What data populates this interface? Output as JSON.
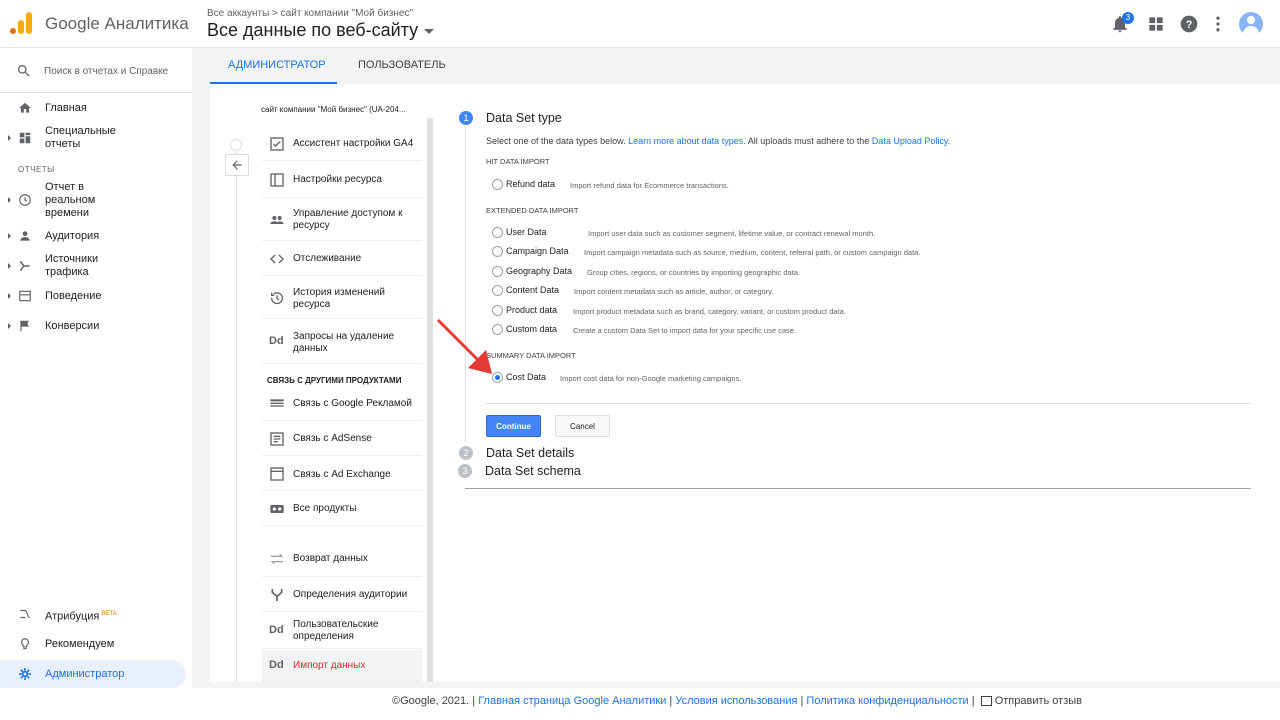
{
  "header": {
    "product": "Google Аналитика",
    "breadcrumb": "Все аккаунты > сайт компании \"Мой бизнес\"",
    "view": "Все данные по веб-сайту",
    "notifications_count": "3"
  },
  "leftnav": {
    "search_placeholder": "Поиск в отчетах и Справке",
    "items": [
      {
        "label": "Главная"
      },
      {
        "label": "Специальные отчеты"
      },
      {
        "label": "Отчет в реальном времени"
      },
      {
        "label": "Аудитория"
      },
      {
        "label": "Источники трафика"
      },
      {
        "label": "Поведение"
      },
      {
        "label": "Конверсии"
      },
      {
        "label": "Атрибуция"
      },
      {
        "label": "Рекомендуем"
      },
      {
        "label": "Администратор"
      }
    ],
    "section_reports": "ОТЧЕТЫ",
    "beta": "BETA"
  },
  "tabs": {
    "admin": "АДМИНИСТРАТОР",
    "user": "ПОЛЬЗОВАТЕЛЬ"
  },
  "property": {
    "title": "сайт компании \"Мой бизнес\" (UA-204...",
    "items": [
      {
        "label": "Ассистент настройки GA4"
      },
      {
        "label": "Настройки ресурса"
      },
      {
        "label": "Управление доступом к ресурсу"
      },
      {
        "label": "Отслеживание"
      },
      {
        "label": "История изменений ресурса"
      },
      {
        "label": "Запросы на удаление данных"
      },
      {
        "label": "Связь с Google Рекламой"
      },
      {
        "label": "Связь с AdSense"
      },
      {
        "label": "Связь с Ad Exchange"
      },
      {
        "label": "Все продукты"
      },
      {
        "label": "Возврат данных"
      },
      {
        "label": "Определения аудитории"
      },
      {
        "label": "Пользовательские определения"
      },
      {
        "label": "Импорт данных"
      }
    ],
    "section_links": "СВЯЗЬ С ДРУГИМИ ПРОДУКТАМИ",
    "dd": "Dd"
  },
  "wizard": {
    "step1_num": "1",
    "step1_title": "Data Set type",
    "intro_text": "Select one of the data types below.",
    "intro_link1": "Learn more about data types.",
    "intro_text2": "All uploads must adhere to the",
    "intro_link2": "Data Upload Policy",
    "intro_end": ".",
    "hit_header": "HIT DATA IMPORT",
    "extended_header": "EXTENDED DATA IMPORT",
    "summary_header": "SUMMARY DATA IMPORT",
    "options": [
      {
        "name": "Refund data",
        "desc": "Import refund data for Ecommerce transactions."
      },
      {
        "name": "User Data",
        "desc": "Import user data such as customer segment, lifetime value, or contract renewal month."
      },
      {
        "name": "Campaign Data",
        "desc": "Import campaign metadata such as source, medium, content, referral path, or custom campaign data."
      },
      {
        "name": "Geography Data",
        "desc": "Group cities, regions, or countries by importing geographic data."
      },
      {
        "name": "Content Data",
        "desc": "Import content metadata such as article, author, or category."
      },
      {
        "name": "Product data",
        "desc": "Import product metadata such as brand, category, variant, or custom product data."
      },
      {
        "name": "Custom data",
        "desc": "Create a custom Data Set to import data for your specific use case."
      },
      {
        "name": "Cost Data",
        "desc": "Import cost data for non-Google marketing campaigns."
      }
    ],
    "continue": "Continue",
    "cancel": "Cancel",
    "step2_num": "2",
    "step2_title": "Data Set details",
    "step3_num": "3",
    "step3_title": "Data Set schema"
  },
  "footer": {
    "copyright": "©Google, 2021. |",
    "link_home": "Главная страница Google Аналитики",
    "sep": "|",
    "link_terms": "Условия использования",
    "link_privacy": "Политика конфиденциальности",
    "feedback": "Отправить отзыв"
  }
}
